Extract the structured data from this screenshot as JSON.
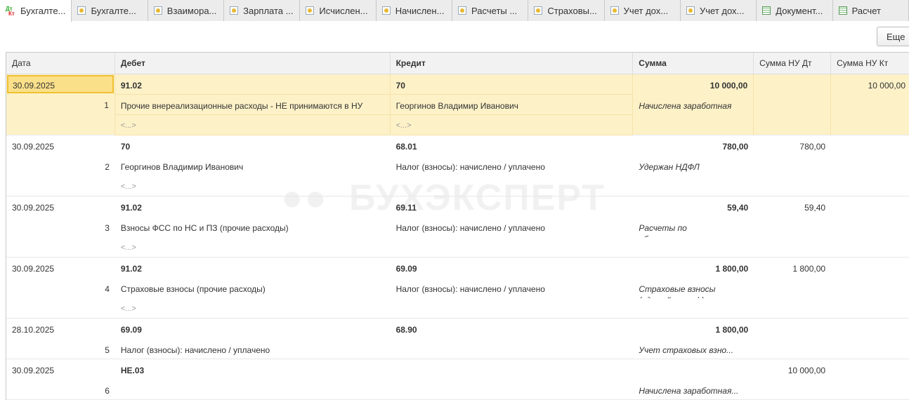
{
  "tabs": [
    {
      "label": "Бухгалте...",
      "icon": "dt-kt-icon",
      "active": true
    },
    {
      "label": "Бухгалте...",
      "icon": "register-icon"
    },
    {
      "label": "Взаимора...",
      "icon": "register-icon"
    },
    {
      "label": "Зарплата ...",
      "icon": "register-icon"
    },
    {
      "label": "Исчислен...",
      "icon": "register-icon"
    },
    {
      "label": "Начислен...",
      "icon": "register-icon"
    },
    {
      "label": "Расчеты ...",
      "icon": "register-icon"
    },
    {
      "label": "Страховы...",
      "icon": "register-icon"
    },
    {
      "label": "Учет дох...",
      "icon": "register-icon"
    },
    {
      "label": "Учет дох...",
      "icon": "register-icon"
    },
    {
      "label": "Документ...",
      "icon": "table-icon"
    },
    {
      "label": "Расчет",
      "icon": "table-icon"
    }
  ],
  "more_label": "Еще",
  "dt_label": "Дт",
  "kt_label": "Кт",
  "watermark": "БУХЭКСПЕРТ",
  "columns": [
    "Дата",
    "Дебет",
    "Кредит",
    "Сумма",
    "Сумма НУ Дт",
    "Сумма НУ Кт"
  ],
  "rows": [
    {
      "date": "30.09.2025",
      "num": "1",
      "debit": "91.02",
      "debit_sub": [
        "Прочие внереализационные расходы - НЕ принимаются в НУ",
        "<...>"
      ],
      "credit": "70",
      "credit_sub": [
        "Георгинов Владимир Иванович",
        "<...>"
      ],
      "sum": "10 000,00",
      "content": "Начислена заработная плата",
      "nu_dt": "",
      "nu_kt": "10 000,00",
      "selected": true
    },
    {
      "date": "30.09.2025",
      "num": "2",
      "debit": "70",
      "debit_sub": [
        "Георгинов Владимир Иванович",
        "<...>"
      ],
      "credit": "68.01",
      "credit_sub": [
        "Налог (взносы): начислено / уплачено",
        ""
      ],
      "sum": "780,00",
      "content": "Удержан НДФЛ",
      "nu_dt": "780,00",
      "nu_kt": ""
    },
    {
      "date": "30.09.2025",
      "num": "3",
      "debit": "91.02",
      "debit_sub": [
        "Взносы ФСС по НС и ПЗ (прочие расходы)",
        "<...>"
      ],
      "credit": "69.11",
      "credit_sub": [
        "Налог (взносы): начислено / уплачено",
        ""
      ],
      "sum": "59,40",
      "content": "Расчеты по обязательному ...",
      "nu_dt": "59,40",
      "nu_kt": ""
    },
    {
      "date": "30.09.2025",
      "num": "4",
      "debit": "91.02",
      "debit_sub": [
        "Страховые взносы (прочие расходы)",
        "<...>"
      ],
      "credit": "69.09",
      "credit_sub": [
        "Налог (взносы): начислено / уплачено",
        ""
      ],
      "sum": "1 800,00",
      "content": "Страховые взносы (единый тариф)",
      "nu_dt": "1 800,00",
      "nu_kt": ""
    },
    {
      "date": "28.10.2025",
      "num": "5",
      "debit": "69.09",
      "debit_sub": [
        "Налог (взносы): начислено / уплачено"
      ],
      "credit": "68.90",
      "credit_sub": [
        ""
      ],
      "sum": "1 800,00",
      "content": "Учет страховых взно...",
      "nu_dt": "",
      "nu_kt": ""
    },
    {
      "date": "30.09.2025",
      "num": "6",
      "debit": "НЕ.03",
      "debit_sub": [
        ""
      ],
      "credit": "",
      "credit_sub": [
        ""
      ],
      "sum": "",
      "content": "Начислена заработная...",
      "nu_dt": "10 000,00",
      "nu_kt": ""
    }
  ]
}
